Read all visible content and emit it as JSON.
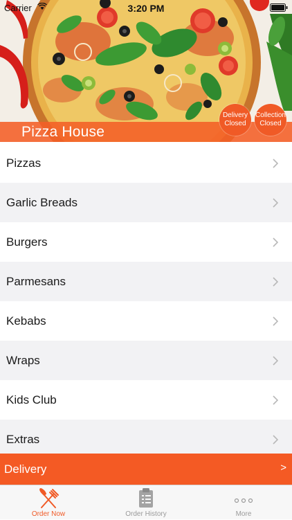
{
  "status_bar": {
    "carrier": "Carrier",
    "time": "3:20 PM"
  },
  "hero": {
    "title": "Pizza House",
    "badges": [
      {
        "line1": "Delivery",
        "line2": "Closed"
      },
      {
        "line1": "Collection",
        "line2": "Closed"
      }
    ]
  },
  "menu": {
    "items": [
      {
        "label": "Pizzas"
      },
      {
        "label": "Garlic Breads"
      },
      {
        "label": "Burgers"
      },
      {
        "label": "Parmesans"
      },
      {
        "label": "Kebabs"
      },
      {
        "label": "Wraps"
      },
      {
        "label": "Kids Club"
      },
      {
        "label": "Extras"
      }
    ]
  },
  "delivery_bar": {
    "label": "Delivery",
    "arrow": ">"
  },
  "tab_bar": {
    "tabs": [
      {
        "label": "Order Now",
        "icon": "fork-knife-icon",
        "active": true
      },
      {
        "label": "Order History",
        "icon": "clipboard-icon",
        "active": false
      },
      {
        "label": "More",
        "icon": "ellipsis-icon",
        "active": false
      }
    ]
  },
  "colors": {
    "accent": "#f45a24",
    "list_alt": "#f2f2f4",
    "tab_inactive": "#9a9a9a"
  }
}
